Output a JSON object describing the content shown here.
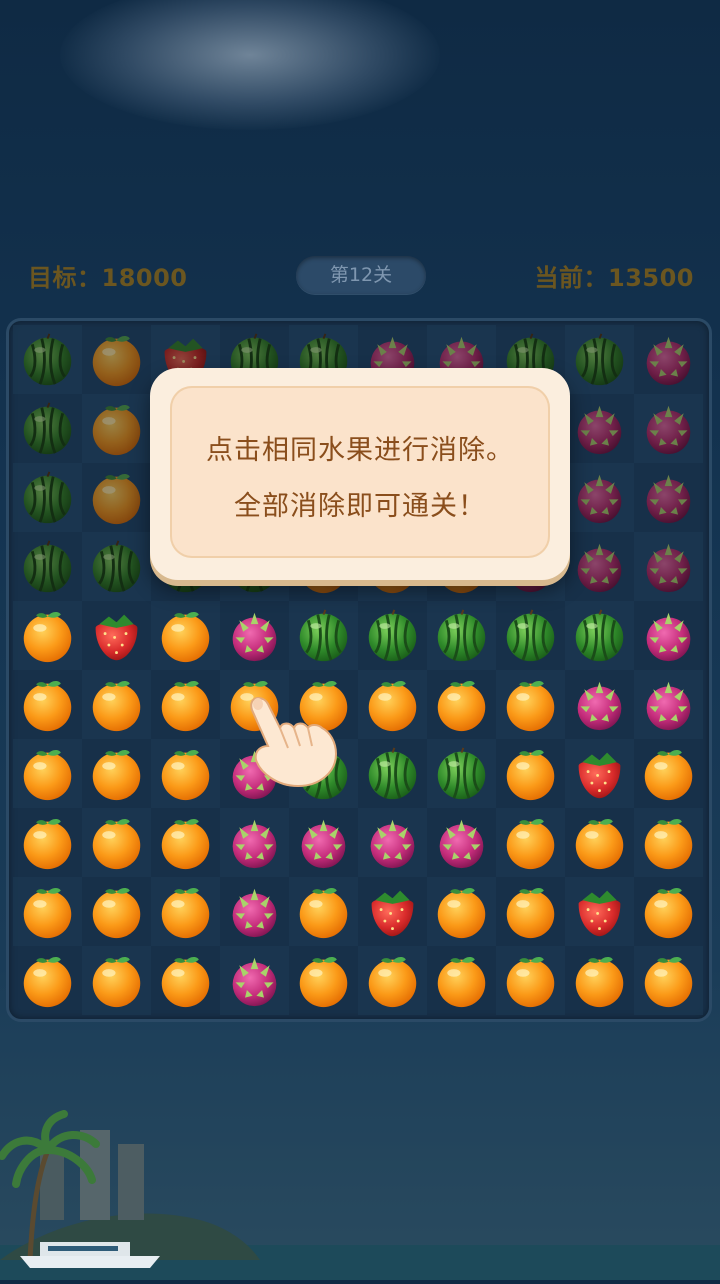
{
  "hud": {
    "target_label": "目标：18000",
    "level_label": "第12关",
    "current_label": "当前：13500"
  },
  "tutorial": {
    "line1": "点击相同水果进行消除。",
    "line2": "全部消除即可通关！"
  },
  "board": {
    "rows": [
      [
        "watermelon",
        "orange",
        "strawberry",
        "watermelon",
        "watermelon",
        "dragonfruit",
        "dragonfruit",
        "watermelon",
        "watermelon",
        "dragonfruit"
      ],
      [
        "watermelon",
        "orange",
        "",
        "",
        "",
        "",
        "",
        "",
        "dragonfruit",
        "dragonfruit"
      ],
      [
        "watermelon",
        "orange",
        "",
        "",
        "",
        "",
        "",
        "",
        "dragonfruit",
        "dragonfruit"
      ],
      [
        "watermelon",
        "watermelon",
        "watermelon",
        "watermelon",
        "orange",
        "orange",
        "orange",
        "dragonfruit",
        "dragonfruit",
        "dragonfruit"
      ],
      [
        "orange",
        "strawberry",
        "orange",
        "dragonfruit",
        "watermelon",
        "watermelon",
        "watermelon",
        "watermelon",
        "watermelon",
        "dragonfruit"
      ],
      [
        "orange",
        "orange",
        "orange",
        "orange",
        "orange",
        "orange",
        "orange",
        "orange",
        "dragonfruit",
        "dragonfruit"
      ],
      [
        "orange",
        "orange",
        "orange",
        "dragonfruit",
        "watermelon",
        "watermelon",
        "watermelon",
        "orange",
        "strawberry",
        "orange"
      ],
      [
        "orange",
        "orange",
        "orange",
        "dragonfruit",
        "dragonfruit",
        "dragonfruit",
        "dragonfruit",
        "orange",
        "orange",
        "orange"
      ],
      [
        "orange",
        "orange",
        "orange",
        "dragonfruit",
        "orange",
        "strawberry",
        "orange",
        "orange",
        "strawberry",
        "orange"
      ],
      [
        "orange",
        "orange",
        "orange",
        "dragonfruit",
        "orange",
        "orange",
        "orange",
        "orange",
        "orange",
        "orange"
      ]
    ],
    "dimmed_rows": [
      0,
      1,
      2,
      3
    ]
  },
  "colors": {
    "hud_text": "#6b5620",
    "dialog_text": "#8a4e1c",
    "orange": "#f7931e",
    "watermelon": "#2e7d32",
    "strawberry": "#d32f2f",
    "dragonfruit": "#b0306a"
  },
  "icons": {
    "watermelon": "watermelon-icon",
    "orange": "orange-icon",
    "strawberry": "strawberry-icon",
    "dragonfruit": "dragonfruit-icon",
    "hand": "pointing-hand-icon"
  }
}
